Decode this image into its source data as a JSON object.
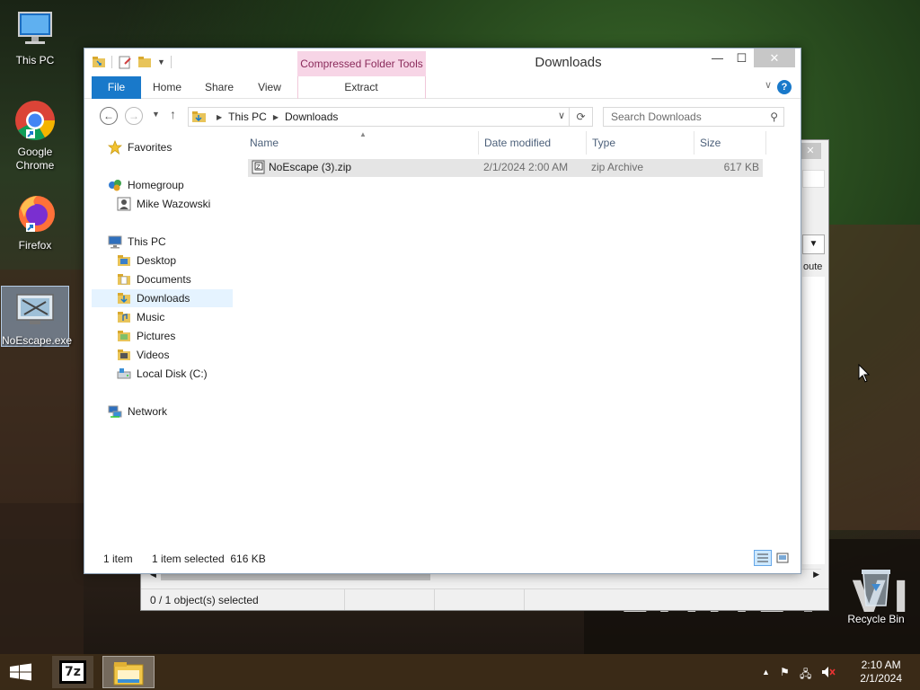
{
  "desktop": {
    "icons": [
      {
        "label": "This PC"
      },
      {
        "label": "Google Chrome"
      },
      {
        "label": "Firefox"
      },
      {
        "label": "NoEscape.exe"
      },
      {
        "label": "Recycle Bin"
      }
    ],
    "wallpaper_text": "EMMET VILLA"
  },
  "background_window": {
    "status_text": "0 / 1 object(s) selected",
    "partial_header": "oute"
  },
  "explorer": {
    "title": "Downloads",
    "contextual_tab_group": "Compressed Folder Tools",
    "tabs": [
      "File",
      "Home",
      "Share",
      "View"
    ],
    "contextual_tab": "Extract",
    "help_glyph": "?",
    "address": {
      "crumbs": [
        "This PC",
        "Downloads"
      ]
    },
    "search": {
      "placeholder": "Search Downloads"
    },
    "nav": {
      "favorites": "Favorites",
      "homegroup": "Homegroup",
      "homegroup_user": "Mike Wazowski",
      "this_pc": "This PC",
      "pc_items": [
        "Desktop",
        "Documents",
        "Downloads",
        "Music",
        "Pictures",
        "Videos",
        "Local Disk (C:)"
      ],
      "network": "Network",
      "selected": "Downloads"
    },
    "columns": [
      "Name",
      "Date modified",
      "Type",
      "Size"
    ],
    "files": [
      {
        "name": "NoEscape (3).zip",
        "date": "2/1/2024 2:00 AM",
        "type": "zip Archive",
        "size": "617 KB"
      }
    ],
    "status": {
      "count": "1 item",
      "selection": "1 item selected  616 KB"
    }
  },
  "taskbar": {
    "app_7z_label": "7z",
    "time": "2:10 AM",
    "date": "2/1/2024"
  },
  "colors": {
    "accent": "#1979ca",
    "contextual": "#f7d5e6",
    "selection": "#e5f3ff"
  }
}
